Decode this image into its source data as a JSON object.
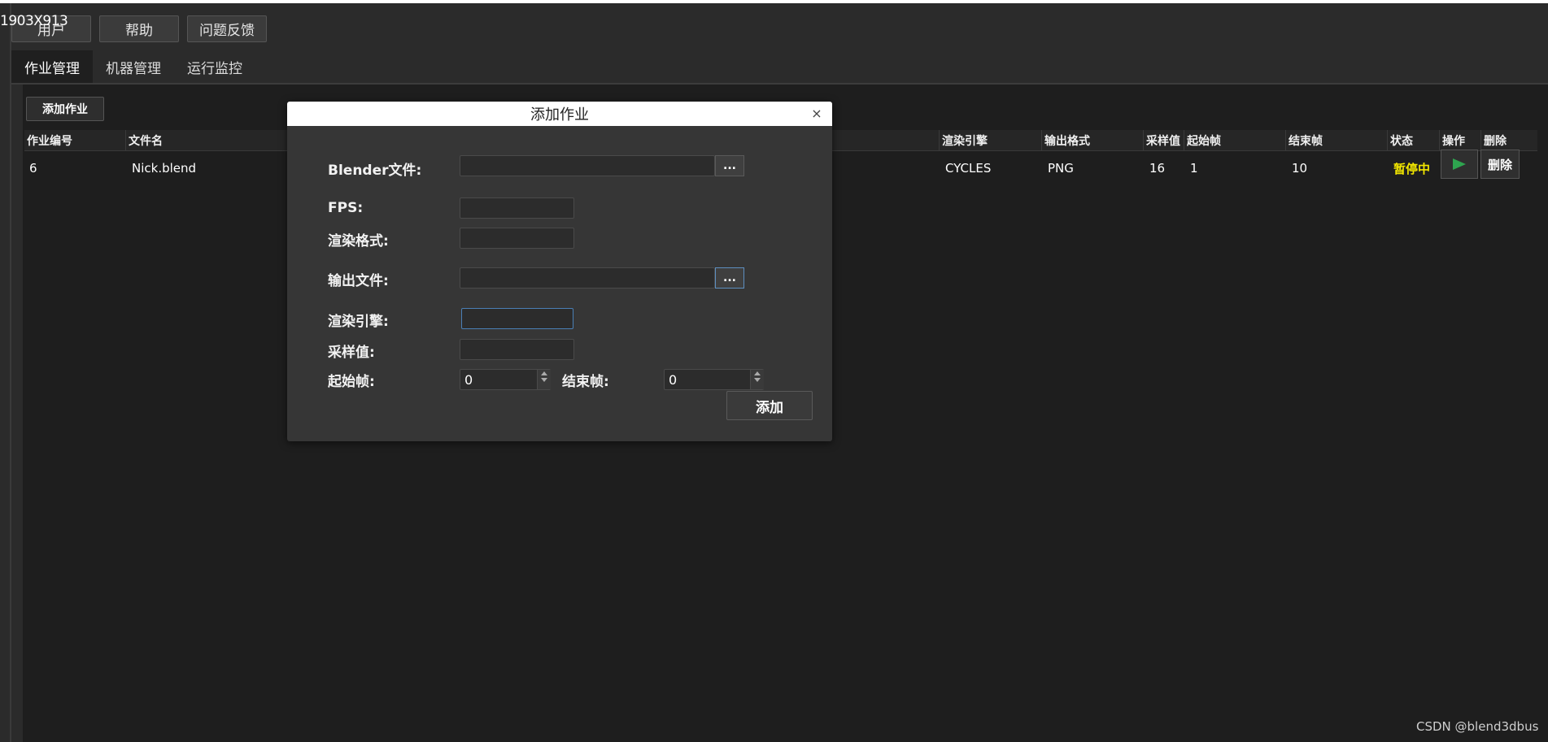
{
  "overlay_label": "1903X913",
  "topbar": {
    "user": "用户",
    "help": "帮助",
    "feedback": "问题反馈"
  },
  "tabs": [
    {
      "label": "作业管理",
      "active": true
    },
    {
      "label": "机器管理",
      "active": false
    },
    {
      "label": "运行监控",
      "active": false
    }
  ],
  "toolbar": {
    "add_job": "添加作业"
  },
  "table": {
    "headers": [
      "作业编号",
      "文件名",
      "渲染引擎",
      "输出格式",
      "采样值",
      "起始帧",
      "结束帧",
      "状态",
      "操作",
      "删除"
    ],
    "rows": [
      {
        "id": "6",
        "file": "Nick.blend",
        "engine": "CYCLES",
        "format": "PNG",
        "samples": "16",
        "start": "1",
        "end": "10",
        "status": "暂停中",
        "delete": "删除"
      }
    ]
  },
  "dialog": {
    "title": "添加作业",
    "close": "×",
    "blender_file_label": "Blender文件:",
    "blender_file_value": "",
    "fps_label": "FPS:",
    "fps_value": "",
    "render_format_label": "渲染格式:",
    "render_format_value": "",
    "output_file_label": "输出文件:",
    "output_file_value": "",
    "engine_label": "渲染引擎:",
    "engine_value": "",
    "samples_label": "采样值:",
    "samples_value": "",
    "start_frame_label": "起始帧:",
    "start_frame_value": "0",
    "end_frame_label": "结束帧:",
    "end_frame_value": "0",
    "browse_label": "...",
    "submit_label": "添加"
  },
  "watermark": "CSDN @blend3dbus",
  "colors": {
    "status": "#f2e600",
    "play": "#2ea44f",
    "focus": "#4a7fb5"
  }
}
